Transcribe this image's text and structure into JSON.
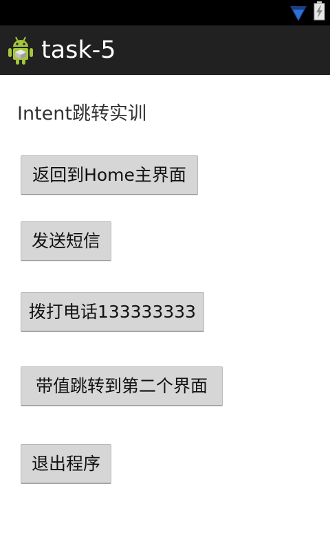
{
  "app": {
    "title": "task-5"
  },
  "main": {
    "heading": "Intent跳转实训",
    "buttons": [
      {
        "id": "home",
        "label": "返回到Home主界面"
      },
      {
        "id": "sms",
        "label": "发送短信"
      },
      {
        "id": "call",
        "label": "拨打电话133333333"
      },
      {
        "id": "value",
        "label": "带值跳转到第二个界面"
      },
      {
        "id": "exit",
        "label": "退出程序"
      }
    ]
  },
  "icons": {
    "status_wifi": "wifi-icon",
    "status_battery": "battery-charging-icon",
    "app_icon": "android-robot-icon"
  },
  "colors": {
    "status_bar": "#000000",
    "action_bar": "#212121",
    "wifi": "#2f6fd6",
    "android_green": "#a4c639",
    "button_bg": "#d6d6d6"
  }
}
